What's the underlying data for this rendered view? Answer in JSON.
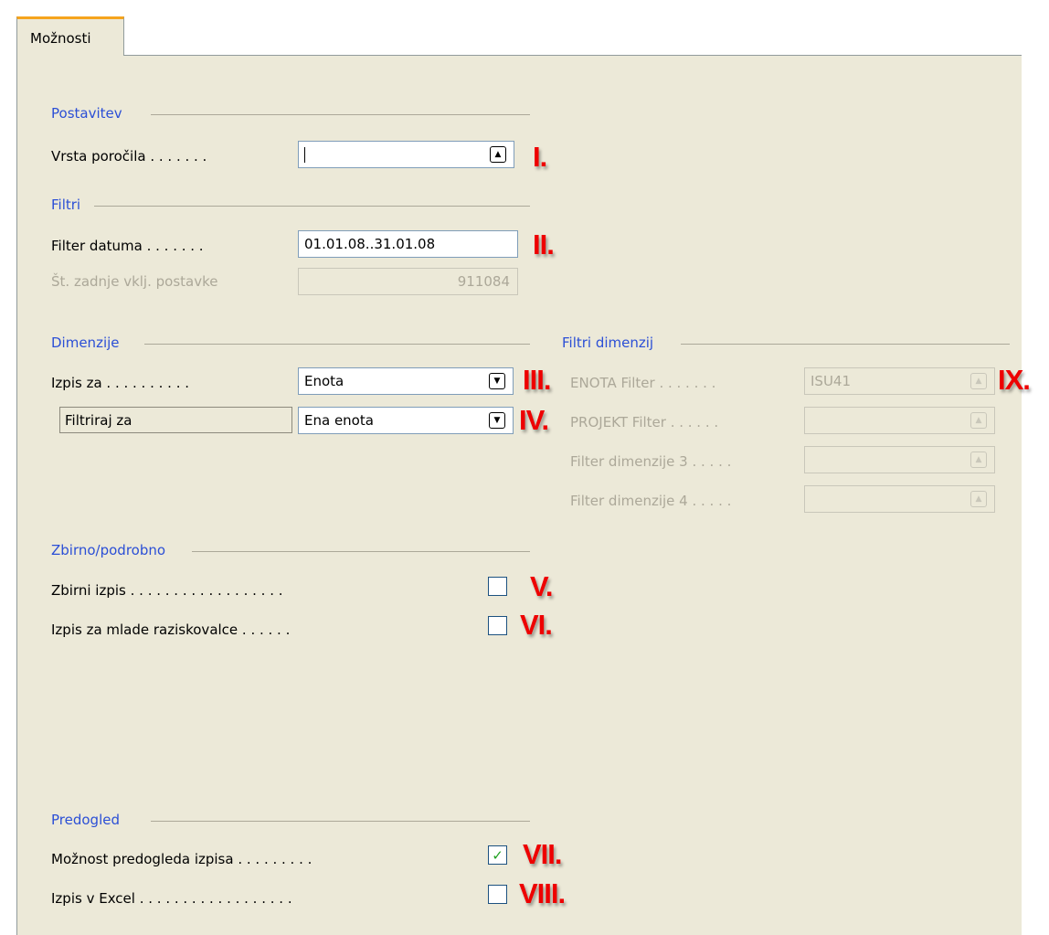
{
  "tab": {
    "label": "Možnosti"
  },
  "sections": {
    "postavitev": "Postavitev",
    "filtri": "Filtri",
    "dimenzije": "Dimenzije",
    "filtri_dimenzij": "Filtri dimenzij",
    "zbirno": "Zbirno/podrobno",
    "predogled": "Predogled"
  },
  "fields": {
    "vrsta_porocila": {
      "label": "Vrsta poročila . . . . . . .",
      "value": ""
    },
    "filter_datuma": {
      "label": "Filter datuma . . . . . . .",
      "value": "01.01.08..31.01.08"
    },
    "st_zadnje": {
      "label": "Št. zadnje vklj. postavke",
      "value": "911084"
    },
    "izpis_za": {
      "label": "Izpis za . . . . . . . . . .",
      "value": "Enota"
    },
    "filtriraj_za": {
      "label": "Filtriraj za",
      "value": "Ena enota"
    },
    "enota_filter": {
      "label": "ENOTA Filter . . . . . . .",
      "value": "ISU41"
    },
    "projekt_filter": {
      "label": "PROJEKT Filter . . . . . .",
      "value": ""
    },
    "filter_dim3": {
      "label": "Filter dimenzije 3 . . . . .",
      "value": ""
    },
    "filter_dim4": {
      "label": "Filter dimenzije 4 . . . . .",
      "value": ""
    }
  },
  "checks": {
    "zbirni_izpis": {
      "label": "Zbirni izpis . . . . . . . . . . . . . . . . . .",
      "checked": false
    },
    "mladi": {
      "label": "Izpis za mlade raziskovalce . . . . . .",
      "checked": false
    },
    "predogled": {
      "label": "Možnost predogleda izpisa . . . . . . . . .",
      "checked": true
    },
    "excel": {
      "label": "Izpis v Excel . . . . . . . . . . . . . . . . . .",
      "checked": false
    }
  },
  "annotations": {
    "i": "I.",
    "ii": "II.",
    "iii": "III.",
    "iv": "IV.",
    "v": "V.",
    "vi": "VI.",
    "vii": "VII.",
    "viii": "VIII.",
    "ix": "IX."
  },
  "icons": {
    "lookup": "up-arrow-lookup-icon",
    "dropdown": "down-arrow-dropdown-icon",
    "check": "checkmark-icon"
  },
  "colors": {
    "section_title": "#2b4fd6",
    "annotation": "#ee0000",
    "tab_accent": "#f6a41d",
    "panel": "#ece9d8"
  }
}
